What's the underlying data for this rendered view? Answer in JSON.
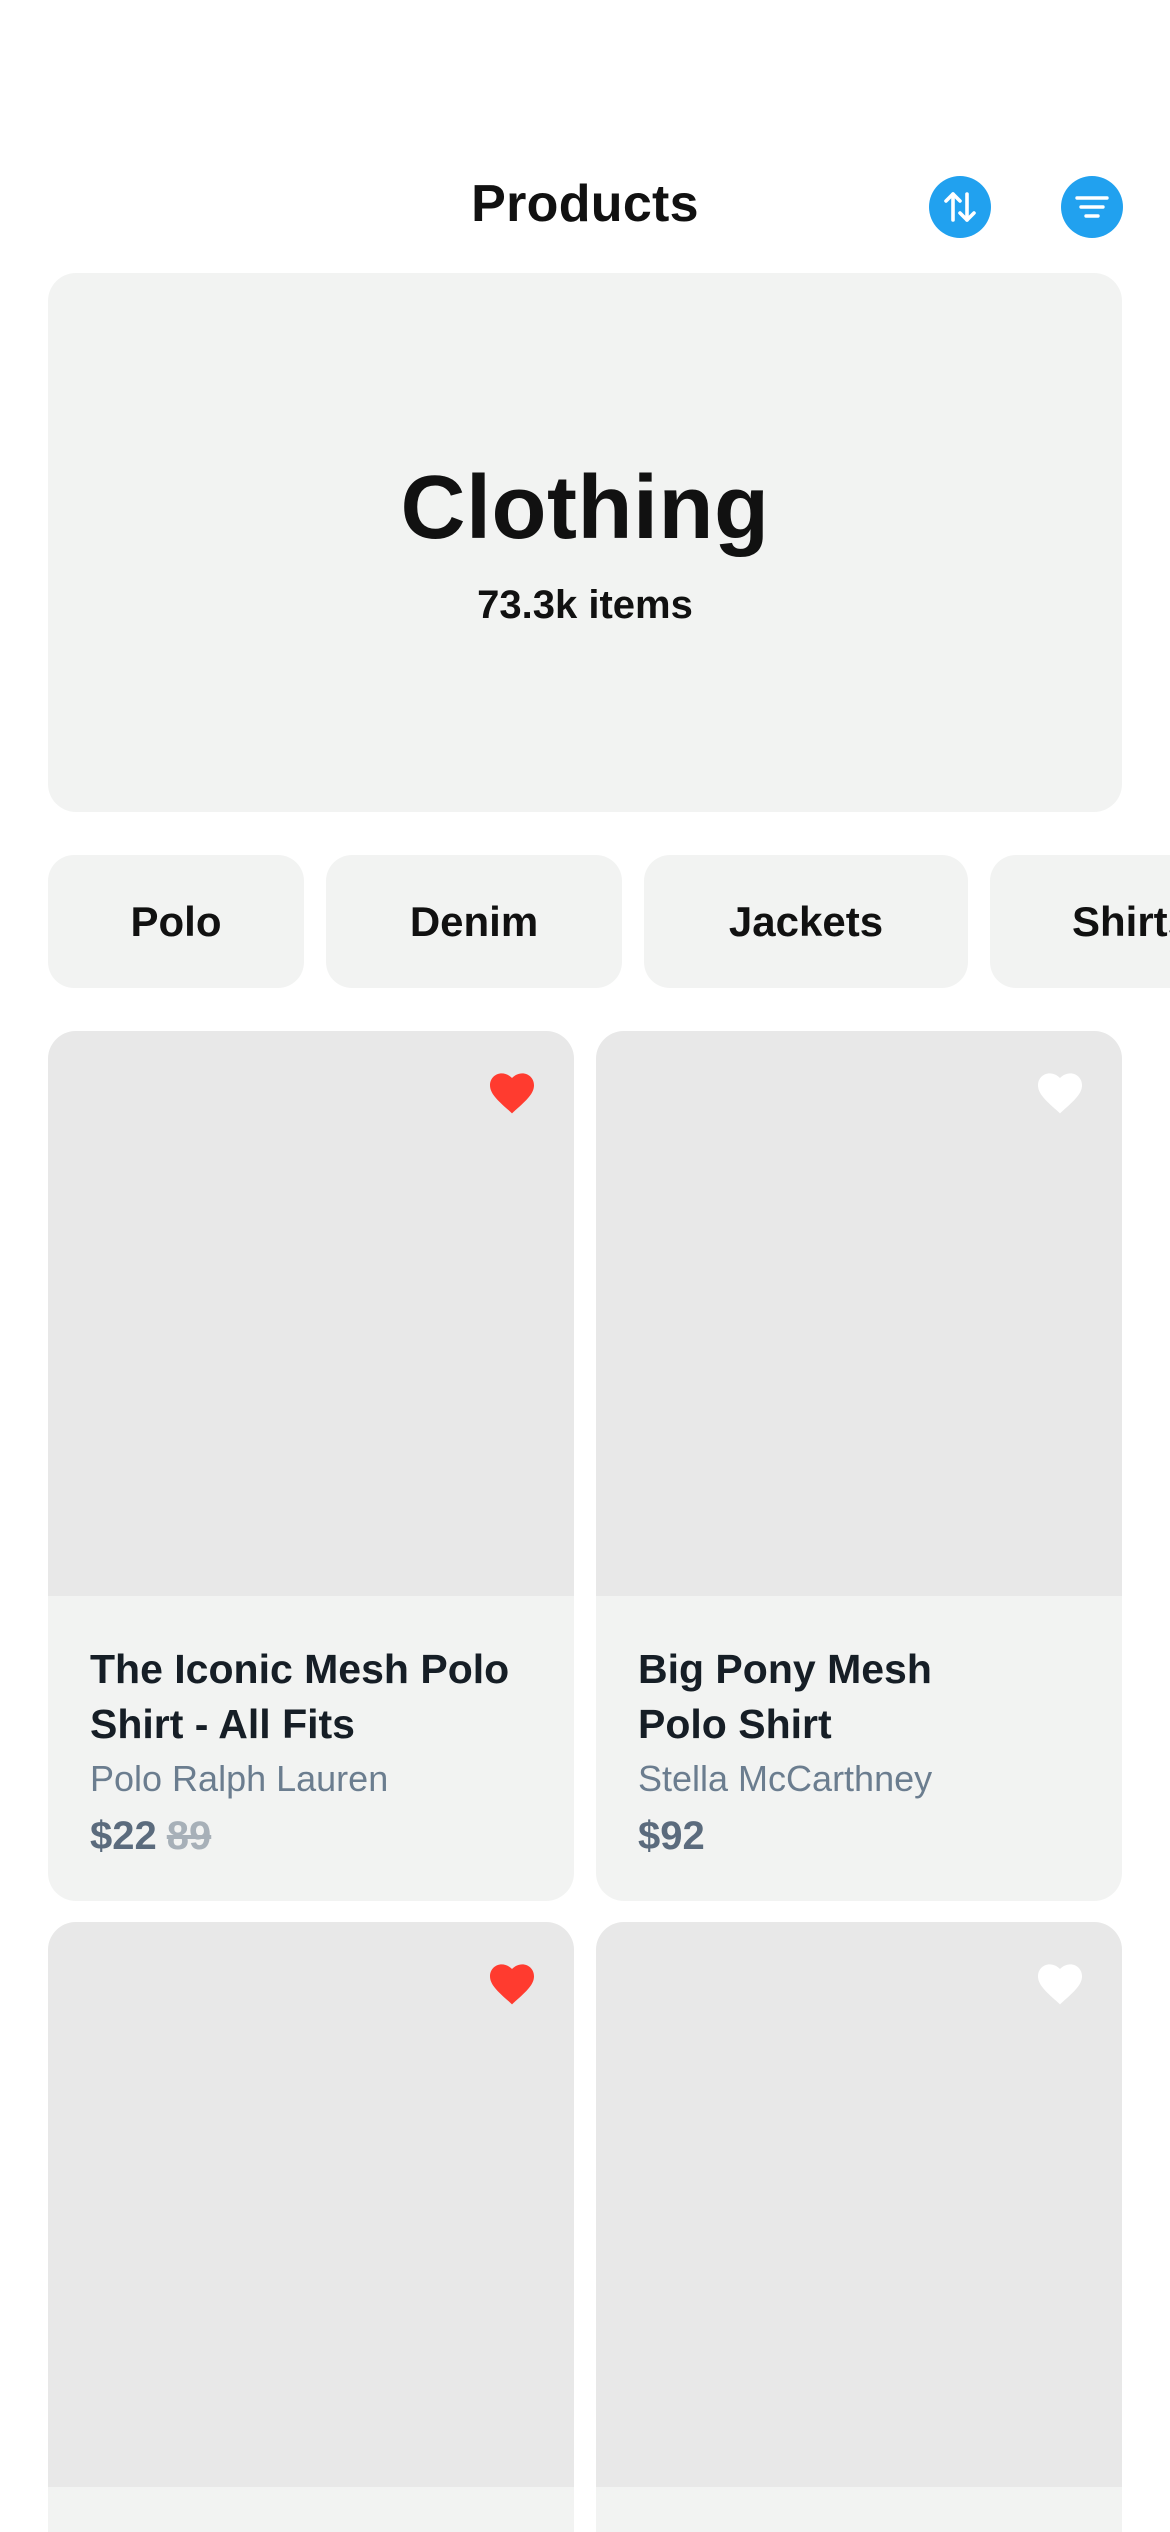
{
  "header": {
    "title": "Products",
    "sort_icon": "sort-arrows-icon",
    "filter_icon": "filter-lines-icon",
    "accent_color": "#21a1ef"
  },
  "hero": {
    "title": "Clothing",
    "count": "73.3k items"
  },
  "chips": [
    "Polo",
    "Denim",
    "Jackets",
    "Shirts"
  ],
  "products": [
    {
      "name_line1": "The Iconic Mesh Polo",
      "name_line2": "Shirt - All Fits",
      "brand": "Polo Ralph Lauren",
      "price": "$22",
      "old_price": "89",
      "favorited": true
    },
    {
      "name_line1": "Big Pony Mesh",
      "name_line2": "Polo Shirt",
      "brand": "Stella McCarthney",
      "price": "$92",
      "old_price": "",
      "favorited": false
    },
    {
      "favorited": true
    },
    {
      "favorited": false
    }
  ],
  "colors": {
    "favorite_active": "#ff3b2f",
    "favorite_inactive": "#ffffff",
    "card_bg": "#f2f3f2",
    "image_placeholder": "#e8e8e8"
  }
}
